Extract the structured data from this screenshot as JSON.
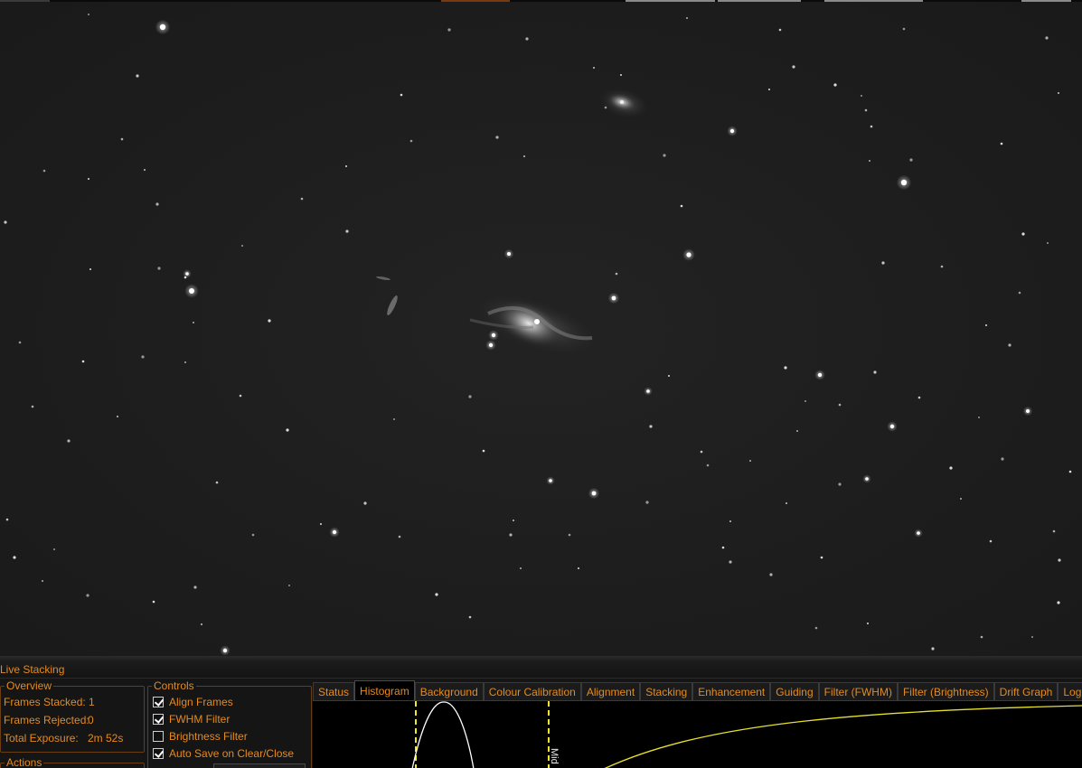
{
  "panel": {
    "title": "Live Stacking"
  },
  "overview": {
    "legend": "Overview",
    "frames_stacked_label": "Frames Stacked:",
    "frames_stacked_value": "1",
    "frames_rejected_label": "Frames Rejected:",
    "frames_rejected_value": "0",
    "total_exposure_label": "Total Exposure:",
    "total_exposure_value": "2m 52s"
  },
  "controls": {
    "legend": "Controls",
    "items": [
      {
        "label": "Align Frames",
        "checked": true
      },
      {
        "label": "FWHM Filter",
        "checked": true
      },
      {
        "label": "Brightness Filter",
        "checked": false
      },
      {
        "label": "Auto Save on Clear/Close",
        "checked": true
      }
    ]
  },
  "actions": {
    "legend": "Actions"
  },
  "tabs": [
    {
      "label": "Status",
      "active": false
    },
    {
      "label": "Histogram",
      "active": true
    },
    {
      "label": "Background",
      "active": false
    },
    {
      "label": "Colour Calibration",
      "active": false
    },
    {
      "label": "Alignment",
      "active": false
    },
    {
      "label": "Stacking",
      "active": false
    },
    {
      "label": "Enhancement",
      "active": false
    },
    {
      "label": "Guiding",
      "active": false
    },
    {
      "label": "Filter (FWHM)",
      "active": false
    },
    {
      "label": "Filter (Brightness)",
      "active": false
    },
    {
      "label": "Drift Graph",
      "active": false
    },
    {
      "label": "Log",
      "active": false
    }
  ],
  "histogram": {
    "mid_marker_label": "Mid"
  },
  "colors": {
    "accent": "#e58a1f",
    "background": "#151515",
    "sky": "#1d1d1d",
    "curve_stretch": "#e6e02a",
    "curve_histogram": "#ffffff",
    "marker": "#f2e62a"
  }
}
